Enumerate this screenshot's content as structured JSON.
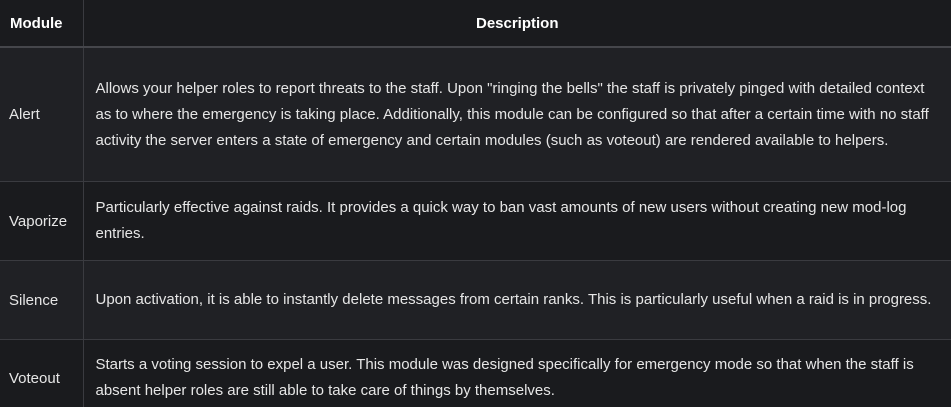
{
  "table": {
    "headers": {
      "module": "Module",
      "description": "Description"
    },
    "rows": [
      {
        "module": "Alert",
        "description": "Allows your helper roles to report threats to the staff. Upon \"ringing the bells\" the staff is privately pinged with detailed context as to where the emergency is taking place. Additionally, this module can be configured so that after a certain time with no staff activity the server enters a state of emergency and certain modules (such as voteout) are rendered available to helpers."
      },
      {
        "module": "Vaporize",
        "description": "Particularly effective against raids. It provides a quick way to ban vast amounts of new users without creating new mod-log entries."
      },
      {
        "module": "Silence",
        "description": "Upon activation, it is able to instantly delete messages from certain ranks. This is particularly useful when a raid is in progress."
      },
      {
        "module": "Voteout",
        "description": "Starts a voting session to expel a user. This module was designed specifically for emergency mode so that when the staff is absent helper roles are still able to take care of things by themselves."
      }
    ]
  }
}
